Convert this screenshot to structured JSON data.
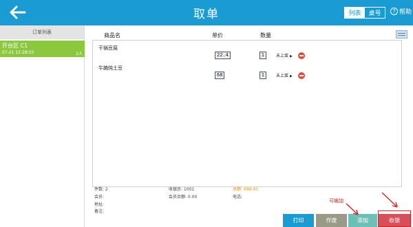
{
  "header": {
    "title": "取单",
    "view_toggle": {
      "list_label": "列表",
      "table_label": "桌号"
    },
    "help_label": "帮助"
  },
  "sidebar": {
    "title": "订单列表",
    "orders": [
      {
        "name": "开台区 C1",
        "time": "07-21 12:28:55",
        "people": "2人"
      }
    ]
  },
  "columns": {
    "dish": "商品名",
    "price": "单价",
    "qty": "数量"
  },
  "dishes": [
    {
      "name": "干锅豆腐",
      "price": "22.4",
      "qty": "1",
      "status": "未上菜"
    },
    {
      "name": "牛腩炖土豆",
      "price": "68",
      "qty": "1",
      "status": "未上菜"
    }
  ],
  "summary": {
    "count": "件数: 2",
    "member": "会员:",
    "address": "地址:",
    "remark": "备注:",
    "cashier": "收银员: 1001",
    "member_balance": "会员余额: 0.00",
    "total": "总额: ¥90.40",
    "phone": "电话:"
  },
  "actions": {
    "print": "打印",
    "void": "作废",
    "add": "添加",
    "checkout": "收银"
  },
  "annotation": {
    "note": "可编加"
  },
  "colors": {
    "header": "#1a9bd1",
    "selected_order": "#8cc83e",
    "checkout": "#d6505c",
    "annotation": "#e02020"
  }
}
